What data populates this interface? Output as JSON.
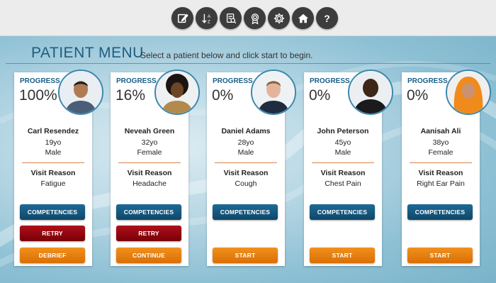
{
  "toolbar": {
    "buttons": [
      {
        "name": "edit-button",
        "icon": "edit-icon"
      },
      {
        "name": "sort-button",
        "icon": "sort-az-icon"
      },
      {
        "name": "report-button",
        "icon": "report-icon"
      },
      {
        "name": "award-button",
        "icon": "award-icon"
      },
      {
        "name": "settings-button",
        "icon": "gear-icon"
      },
      {
        "name": "home-button",
        "icon": "home-icon"
      },
      {
        "name": "help-button",
        "icon": "help-icon",
        "label": "?"
      }
    ]
  },
  "menu": {
    "title": "PATIENT MENU",
    "subtitle": "Select a patient below and click start to begin."
  },
  "labels": {
    "progress": "PROGRESS",
    "visit_reason": "Visit Reason"
  },
  "colors": {
    "accent": "#1a5e86",
    "competencies": "#0f4767",
    "retry": "#8a0a12",
    "action": "#e8800f"
  },
  "patients": [
    {
      "progress": "100%",
      "name": "Carl Resendez",
      "age": "19yo",
      "sex": "Male",
      "visit_reason": "Fatigue",
      "buttons": {
        "competencies": "COMPETENCIES",
        "retry": "RETRY",
        "action": "DEBRIEF"
      }
    },
    {
      "progress": "16%",
      "name": "Neveah Green",
      "age": "32yo",
      "sex": "Female",
      "visit_reason": "Headache",
      "buttons": {
        "competencies": "COMPETENCIES",
        "retry": "RETRY",
        "action": "CONTINUE"
      }
    },
    {
      "progress": "0%",
      "name": "Daniel Adams",
      "age": "28yo",
      "sex": "Male",
      "visit_reason": "Cough",
      "buttons": {
        "competencies": "COMPETENCIES",
        "action": "START"
      }
    },
    {
      "progress": "0%",
      "name": "John Peterson",
      "age": "45yo",
      "sex": "Male",
      "visit_reason": "Chest Pain",
      "buttons": {
        "competencies": "COMPETENCIES",
        "action": "START"
      }
    },
    {
      "progress": "0%",
      "name": "Aanisah Ali",
      "age": "38yo",
      "sex": "Female",
      "visit_reason": "Right Ear Pain",
      "buttons": {
        "competencies": "COMPETENCIES",
        "action": "START"
      }
    }
  ]
}
